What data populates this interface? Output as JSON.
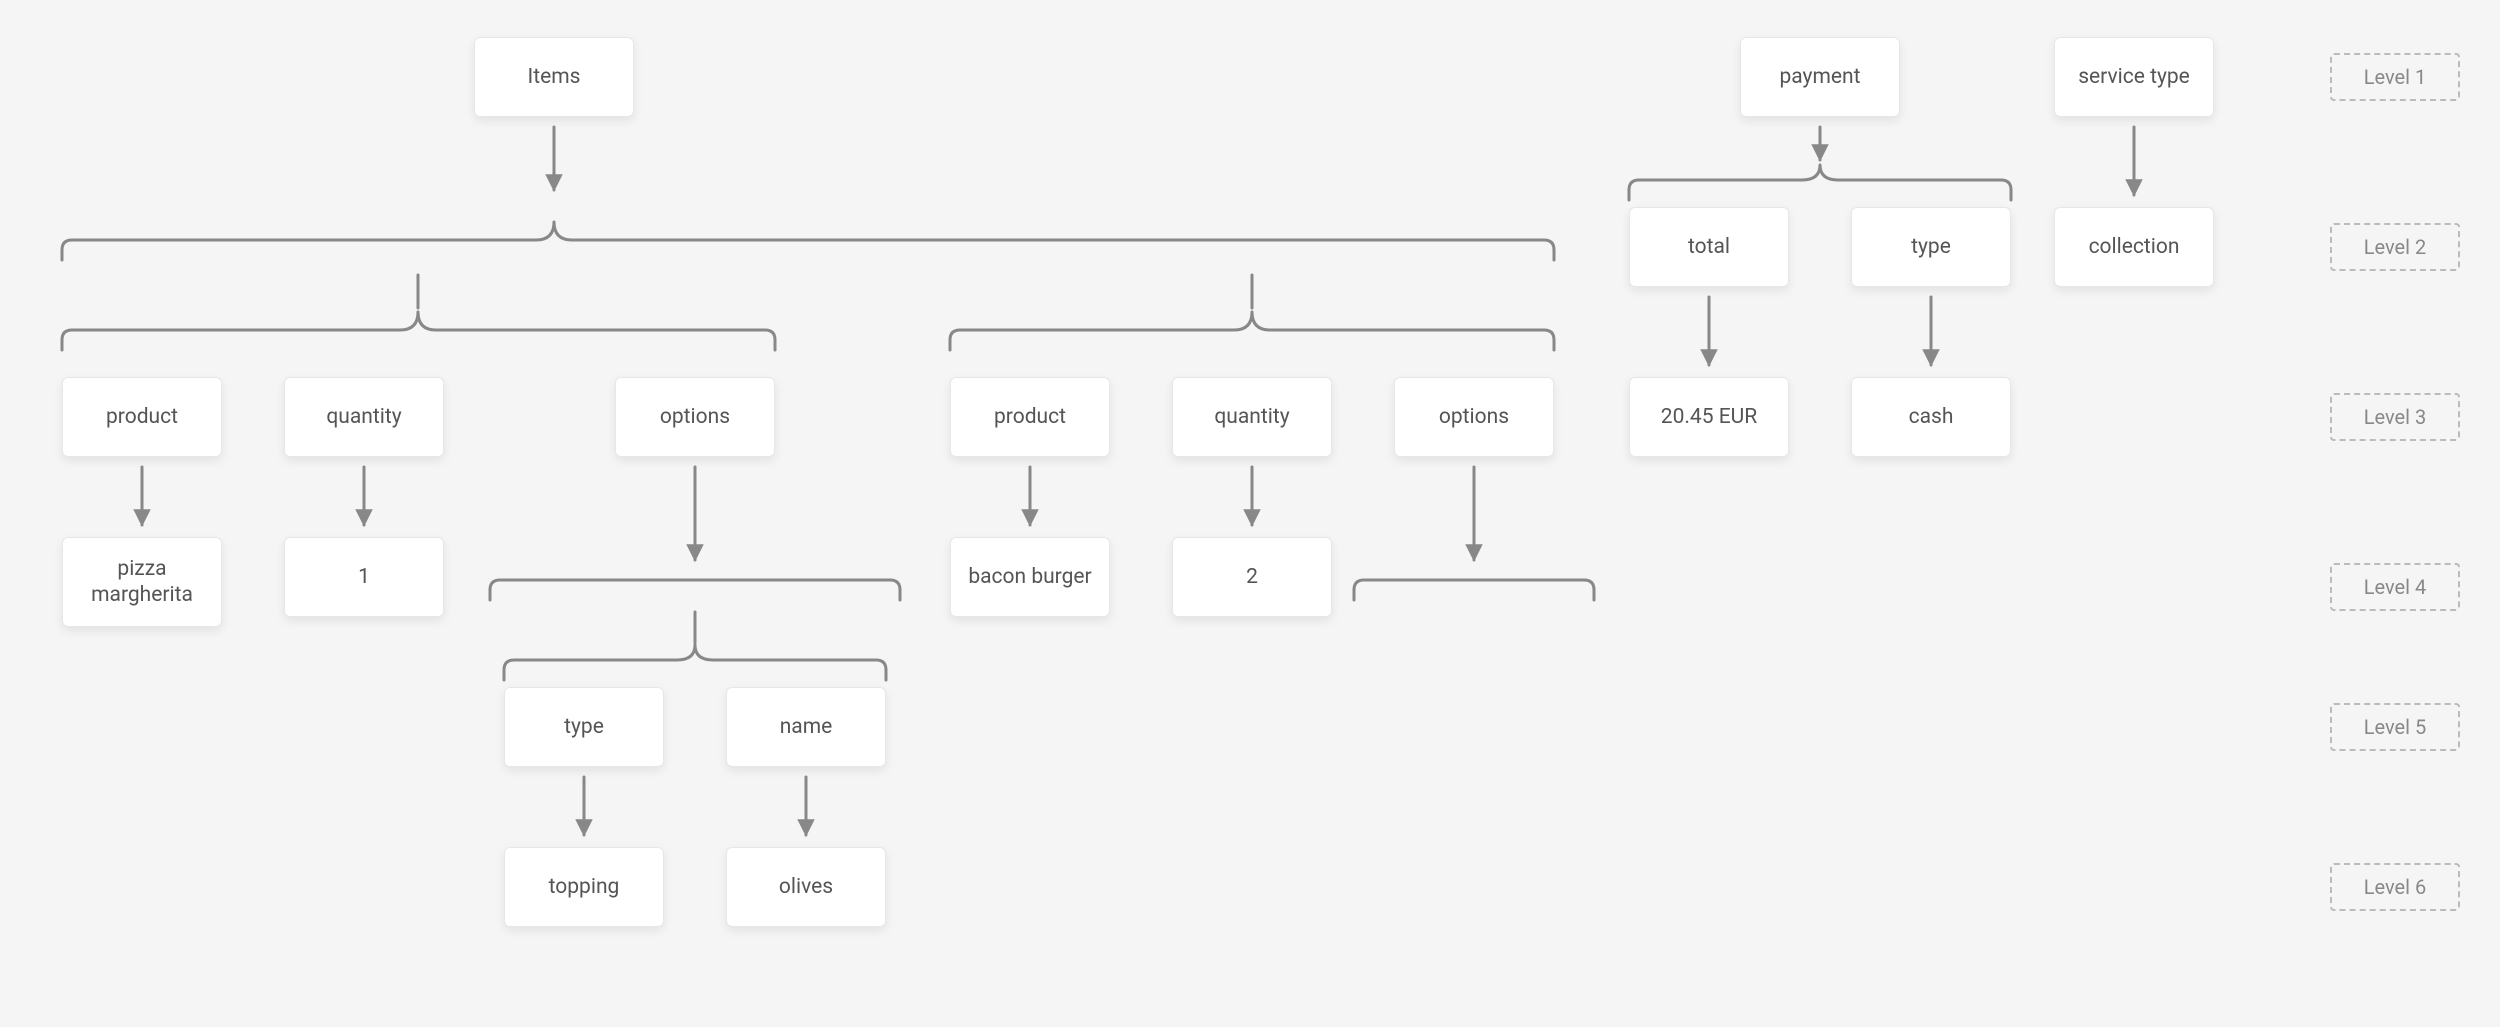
{
  "levels": {
    "l1": "Level 1",
    "l2": "Level 2",
    "l3": "Level 3",
    "l4": "Level 4",
    "l5": "Level 5",
    "l6": "Level 6"
  },
  "nodes": {
    "items": "Items",
    "payment": "payment",
    "service_type": "service type",
    "total": "total",
    "pay_type": "type",
    "collection": "collection",
    "total_value": "20.45 EUR",
    "pay_type_value": "cash",
    "product1": "product",
    "quantity1": "quantity",
    "options1": "options",
    "product2": "product",
    "quantity2": "quantity",
    "options2": "options",
    "pizza": "pizza margherita",
    "qty1": "1",
    "burger": "bacon burger",
    "qty2": "2",
    "opt_type": "type",
    "opt_name": "name",
    "topping": "topping",
    "olives": "olives"
  },
  "tree": {
    "Items": [
      {
        "product": "pizza margherita",
        "quantity": 1,
        "options": [
          {
            "type": "topping",
            "name": "olives"
          }
        ]
      },
      {
        "product": "bacon burger",
        "quantity": 2,
        "options": []
      }
    ],
    "payment": {
      "total": "20.45 EUR",
      "type": "cash"
    },
    "service type": "collection"
  }
}
